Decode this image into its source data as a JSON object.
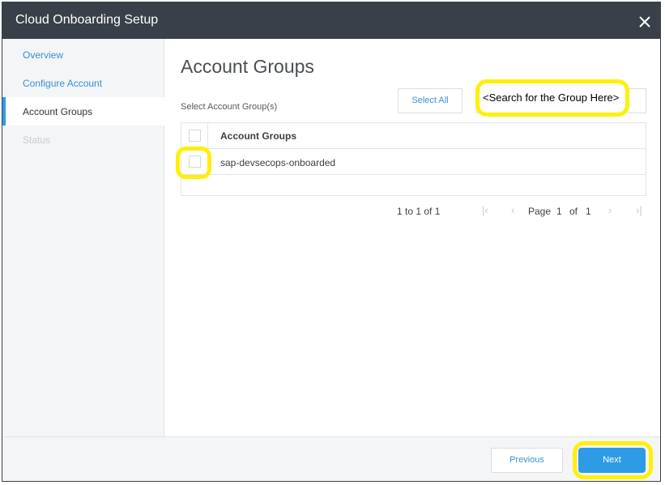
{
  "dialog": {
    "title": "Cloud Onboarding Setup"
  },
  "sidebar": {
    "items": [
      {
        "label": "Overview"
      },
      {
        "label": "Configure Account"
      },
      {
        "label": "Account Groups"
      },
      {
        "label": "Status"
      }
    ]
  },
  "main": {
    "title": "Account Groups",
    "subtitle": "Select Account Group(s)",
    "select_all_label": "Select All",
    "search_placeholder": "<Search for the Group Here>",
    "table": {
      "column_header": "Account Groups",
      "rows": [
        {
          "name": "sap-devsecops-onboarded",
          "checked": false
        }
      ]
    },
    "pagination": {
      "range": "1 to 1 of 1",
      "page_label": "Page",
      "current_page": "1",
      "of_label": "of",
      "total_pages": "1"
    }
  },
  "footer": {
    "previous_label": "Previous",
    "next_label": "Next"
  },
  "colors": {
    "header_bg": "#3a4049",
    "accent": "#2e9be6",
    "highlight": "#ffef0a",
    "link": "#3a8fd9"
  }
}
